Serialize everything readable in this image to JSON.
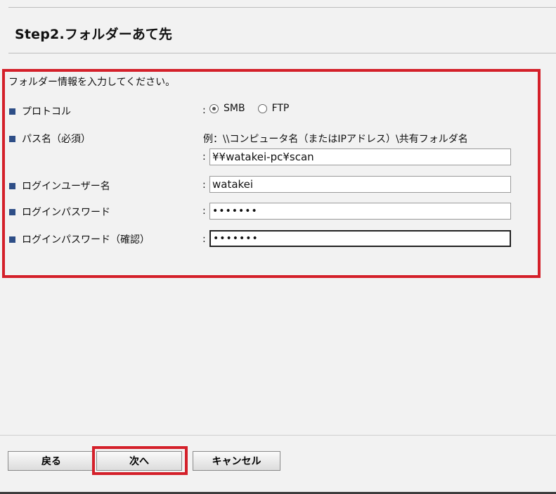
{
  "page": {
    "title": "Step2.フォルダーあて先",
    "intro": "フォルダー情報を入力してください。"
  },
  "form": {
    "protocol": {
      "label": "プロトコル",
      "colon": ":",
      "options": [
        "SMB",
        "FTP"
      ],
      "selected": "SMB"
    },
    "path": {
      "label": "パス名（必須）",
      "hint": "例：\\\\コンピュータ名（またはIPアドレス）\\共有フォルダ名",
      "colon": ":",
      "value": "¥¥watakei-pc¥scan"
    },
    "username": {
      "label": "ログインユーザー名",
      "colon": ":",
      "value": "watakei"
    },
    "password": {
      "label": "ログインパスワード",
      "colon": ":",
      "value": "•••••••"
    },
    "password_confirm": {
      "label": "ログインパスワード（確認）",
      "colon": ":",
      "value": "•••••••"
    }
  },
  "buttons": {
    "back": "戻る",
    "next": "次へ",
    "cancel": "キャンセル"
  },
  "colors": {
    "highlight": "#d4202a",
    "bullet": "#2e4e87",
    "background": "#f2f2f2"
  }
}
